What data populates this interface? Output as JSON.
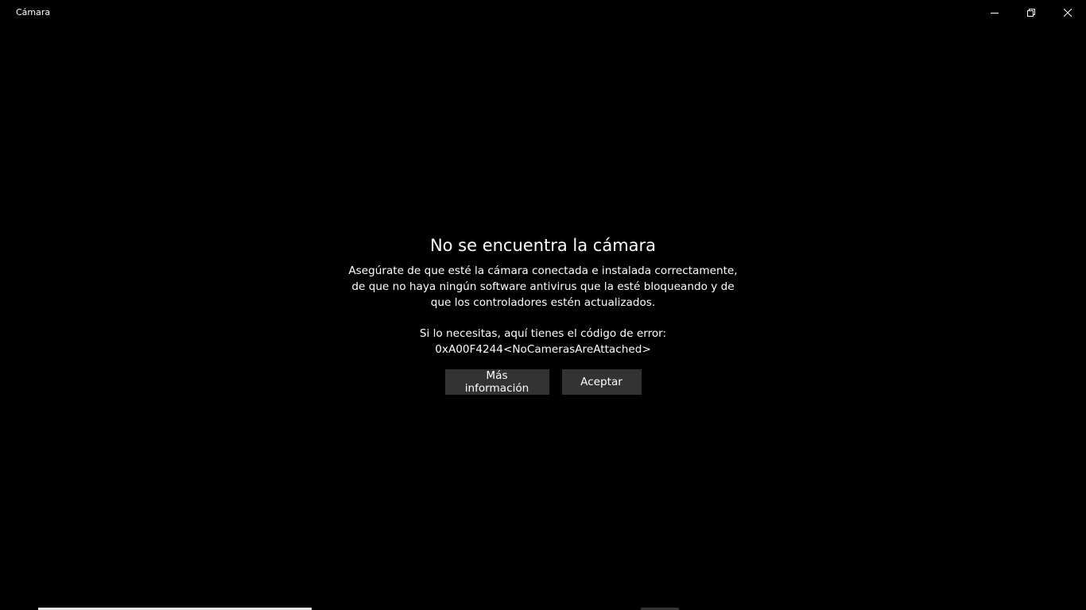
{
  "app": {
    "title": "Cámara"
  },
  "caption_buttons": {
    "minimize_icon": "minimize-icon",
    "restore_icon": "restore-icon",
    "close_icon": "close-icon"
  },
  "dialog": {
    "title": "No se encuentra la cámara",
    "message": "Asegúrate de que esté la cámara conectada e instalada correctamente, de que no haya ningún software antivirus que la esté bloqueando y de que los controladores estén actualizados.",
    "error_intro": "Si lo necesitas, aquí tienes el código de error:",
    "error_code": "0xA00F4244<NoCamerasAreAttached>",
    "more_info_label": "Más información",
    "accept_label": "Aceptar"
  },
  "colors": {
    "background": "#000000",
    "text": "#ffffff",
    "button_bg": "#333333"
  }
}
